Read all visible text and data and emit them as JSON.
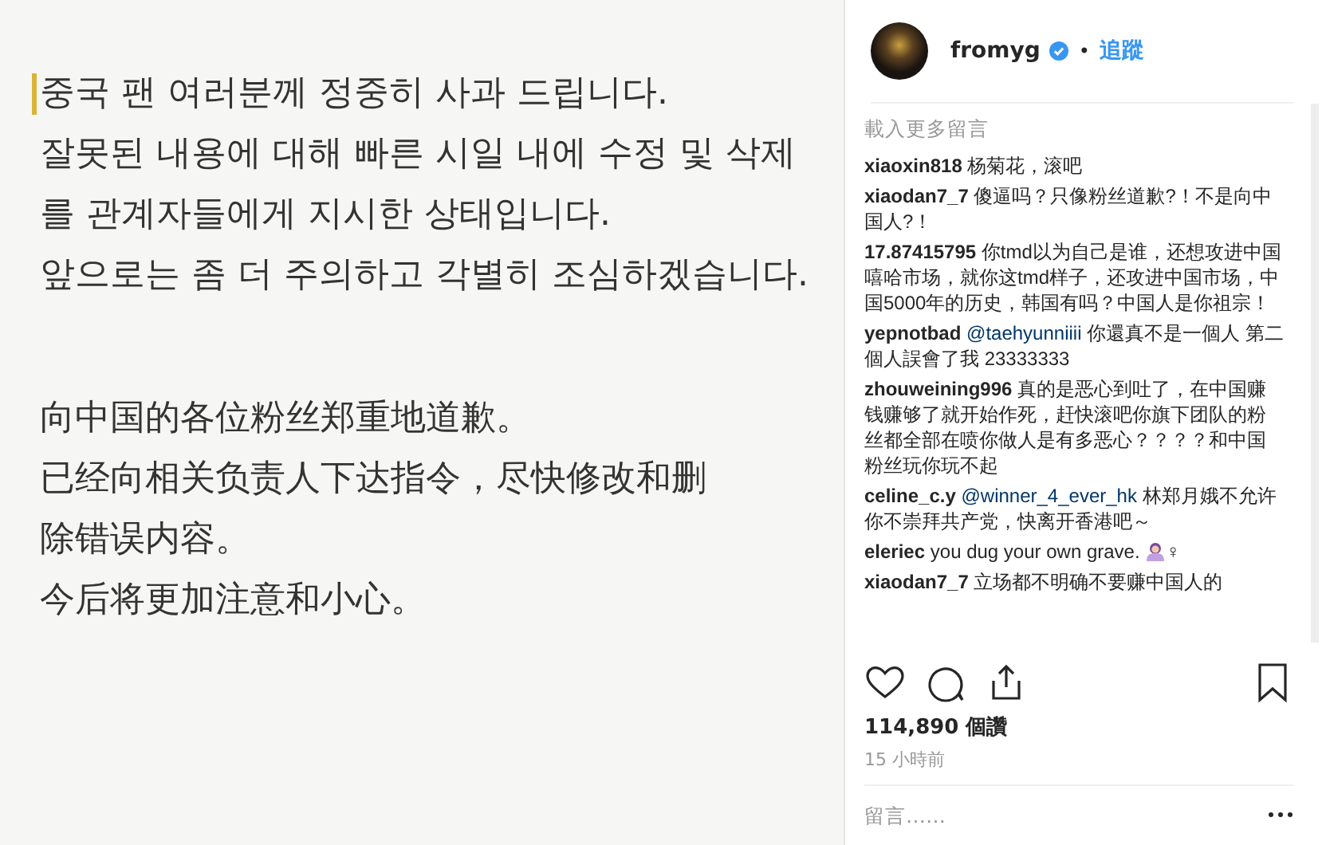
{
  "note": {
    "paragraphs": [
      {
        "lines": [
          "중국 팬 여러분께 정중히 사과 드립니다.",
          "잘못된 내용에 대해 빠른 시일 내에 수정 및 삭제",
          "를 관계자들에게 지시한 상태입니다.",
          "앞으로는 좀 더 주의하고 각별히 조심하겠습니다."
        ]
      },
      {
        "lines": [
          "向中国的各位粉丝郑重地道歉。",
          "已经向相关负责人下达指令，尽快修改和删",
          "除错误内容。",
          "今后将更加注意和小心。"
        ]
      }
    ]
  },
  "header": {
    "username": "fromyg",
    "verified": true,
    "separator": "•",
    "follow": "追蹤"
  },
  "load_more": "載入更多留言",
  "comments": [
    {
      "user": "xiaoxin818",
      "text": "杨菊花，滚吧"
    },
    {
      "user": "xiaodan7_7",
      "text": "傻逼吗？只像粉丝道歉?！不是向中国人?！"
    },
    {
      "user": "17.87415795",
      "text": "你tmd以为自己是谁，还想攻进中国嘻哈市场，就你这tmd样子，还攻进中国市场，中国5000年的历史，韩国有吗？中国人是你祖宗！"
    },
    {
      "user": "yepnotbad",
      "mention": "@taehyunniiii",
      "text": "你還真不是一個人 第二個人誤會了我 23333333"
    },
    {
      "user": "zhouweining996",
      "text": "真的是恶心到吐了，在中国赚钱赚够了就开始作死，赶快滚吧你旗下团队的粉丝都全部在喷你做人是有多恶心？？？？和中国粉丝玩你玩不起"
    },
    {
      "user": "celine_c.y",
      "mention": "@winner_4_ever_hk",
      "text": "林郑月娥不允许你不崇拜共产党，快离开香港吧～"
    },
    {
      "user": "eleriec",
      "text": "you dug your own grave.",
      "emoji": true,
      "trail": "♀"
    },
    {
      "user": "xiaodan7_7",
      "text": "立场都不明确不要赚中国人的"
    }
  ],
  "likes": "114,890 個讚",
  "time": "15 小時前",
  "comment_field": {
    "placeholder": "留言……"
  }
}
